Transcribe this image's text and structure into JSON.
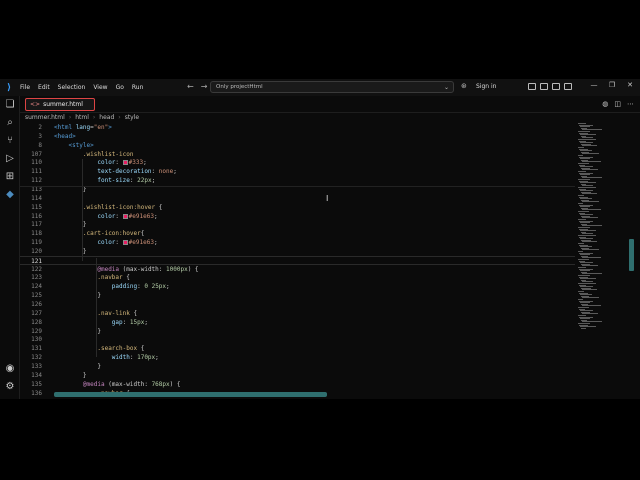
{
  "titlebar": {
    "menu": [
      "File",
      "Edit",
      "Selection",
      "View",
      "Go",
      "Run"
    ],
    "search_text": "Only projectHtml",
    "signin_label": "Sign in"
  },
  "tab": {
    "label": "summer.html"
  },
  "breadcrumb": [
    "summer.html",
    "html",
    "head",
    "style"
  ],
  "editor": {
    "lines": [
      {
        "n": "2",
        "code": "<html lang=\"en\">"
      },
      {
        "n": "3",
        "code": "<head>"
      },
      {
        "n": "8",
        "code": "    <style>"
      },
      {
        "n": "107",
        "code": "        .wishlist-icon"
      },
      {
        "n": "110",
        "code": "            color: #333;"
      },
      {
        "n": "111",
        "code": "            text-decoration: none;"
      },
      {
        "n": "112",
        "code": "            font-size: 22px;"
      },
      {
        "n": "113",
        "code": "        }"
      },
      {
        "n": "114",
        "code": ""
      },
      {
        "n": "115",
        "code": "        .wishlist-icon:hover {"
      },
      {
        "n": "116",
        "code": "            color: #e91e63;"
      },
      {
        "n": "117",
        "code": "        }"
      },
      {
        "n": "118",
        "code": "        .cart-icon:hover{"
      },
      {
        "n": "119",
        "code": "            color: #e91e63;"
      },
      {
        "n": "120",
        "code": "        }"
      },
      {
        "n": "121",
        "code": ""
      },
      {
        "n": "122",
        "code": "            @media (max-width: 1000px) {"
      },
      {
        "n": "123",
        "code": "            .navbar {"
      },
      {
        "n": "124",
        "code": "                padding: 0 25px;"
      },
      {
        "n": "125",
        "code": "            }"
      },
      {
        "n": "126",
        "code": ""
      },
      {
        "n": "127",
        "code": "            .nav-link {"
      },
      {
        "n": "128",
        "code": "                gap: 15px;"
      },
      {
        "n": "129",
        "code": "            }"
      },
      {
        "n": "130",
        "code": ""
      },
      {
        "n": "131",
        "code": "            .search-box {"
      },
      {
        "n": "132",
        "code": "                width: 170px;"
      },
      {
        "n": "133",
        "code": "            }"
      },
      {
        "n": "134",
        "code": "        }"
      },
      {
        "n": "135",
        "code": "        @media (max-width: 768px) {"
      },
      {
        "n": "136",
        "code": "            .navbar {"
      }
    ]
  },
  "colors": {
    "accent": "#e91e63",
    "tab_border": "#dd4444",
    "scrollbar": "#2f6f6f"
  }
}
